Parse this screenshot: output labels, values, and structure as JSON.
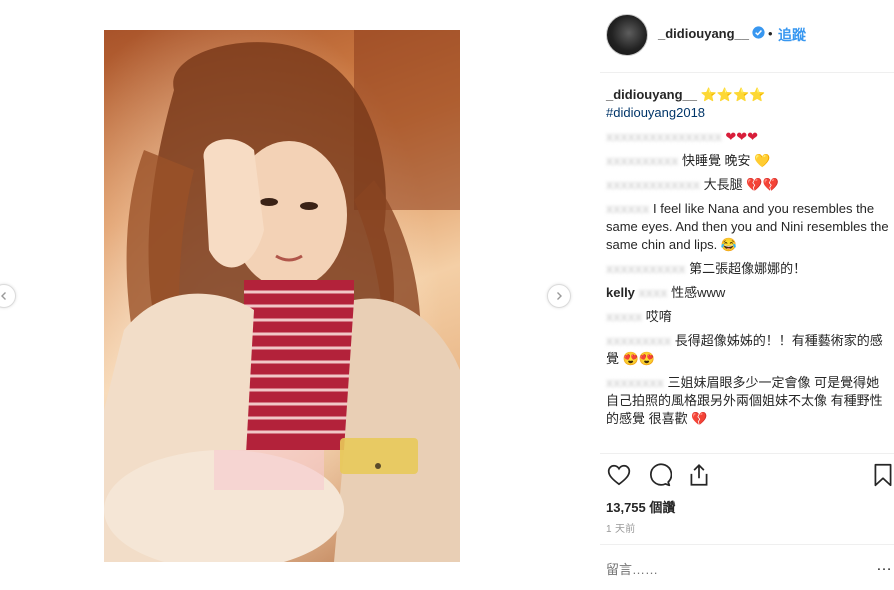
{
  "post": {
    "username": "_didiouyang__",
    "follow_label": "追蹤",
    "separator": "•",
    "views": "13,755 個讚",
    "time": "1 天前",
    "comment_placeholder": "留言……",
    "more_label": "…"
  },
  "caption": {
    "username": "_didiouyang__",
    "stars": "⭐⭐⭐⭐",
    "hashtag": "#didiouyang2018"
  },
  "comments": [
    {
      "user": "",
      "text": "",
      "emoji": "❤❤❤"
    },
    {
      "user": "",
      "text": "快睡覺 晚安",
      "emoji": "💛"
    },
    {
      "user": "",
      "text": "大長腿",
      "emoji": "💔💔"
    },
    {
      "user": "",
      "text": "I feel like Nana and you resembles the same eyes. And then you and Nini resembles the same chin and lips.",
      "emoji": "😂"
    },
    {
      "user": "",
      "text": "第二張超像娜娜的！"
    },
    {
      "user": "kelly",
      "text": "性感www"
    },
    {
      "user": "",
      "text": "哎唷"
    },
    {
      "user": "",
      "text": "長得超像姊姊的！！有種藝術家的感覺",
      "emoji": "😍😍"
    },
    {
      "user": "",
      "text": "三姐妹眉眼多少一定會像 可是覺得她自己拍照的風格跟另外兩個姐妹不太像 有種野性的感覺 很喜歡",
      "emoji": "💔"
    }
  ],
  "icons": {
    "prev": "chevron-left-icon",
    "next": "chevron-right-icon",
    "like": "heart-icon",
    "comment": "comment-bubble-icon",
    "share": "share-icon",
    "save": "bookmark-icon",
    "verified": "verified-badge-icon"
  },
  "colors": {
    "link": "#3897f0",
    "hashtag": "#003569",
    "text": "#262626",
    "muted": "#999999"
  }
}
